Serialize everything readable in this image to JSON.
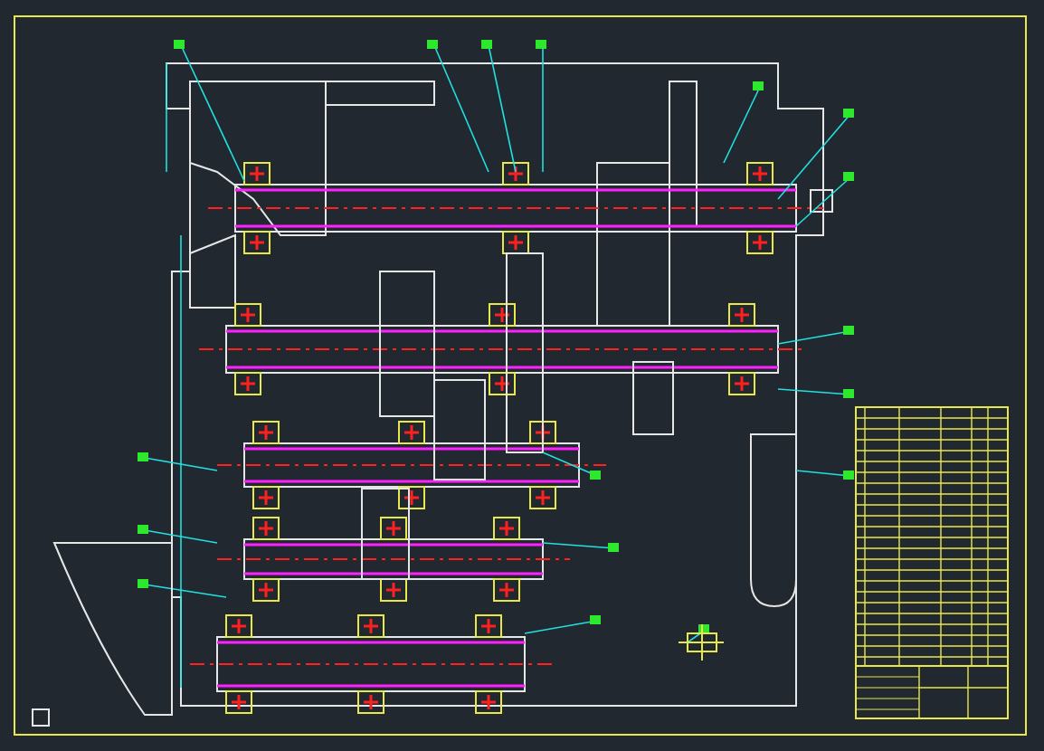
{
  "sheet": {
    "kind": "assembly-drawing"
  }
}
